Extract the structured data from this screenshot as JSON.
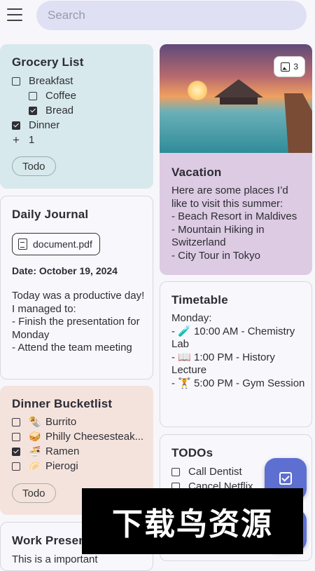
{
  "search": {
    "placeholder": "Search"
  },
  "grocery": {
    "title": "Grocery List",
    "items": [
      {
        "label": "Breakfast",
        "checked": false,
        "indent": false
      },
      {
        "label": "Coffee",
        "checked": false,
        "indent": true
      },
      {
        "label": "Bread",
        "checked": true,
        "indent": true
      },
      {
        "label": "Dinner",
        "checked": true,
        "indent": false
      }
    ],
    "more_label": "1",
    "tag": "Todo"
  },
  "vacation": {
    "image_count": "3",
    "title": "Vacation",
    "body": "Here are some places I’d like to visit this summer:\n- Beach Resort in Maldives\n- Mountain Hiking in Switzerland\n- City Tour in Tokyo"
  },
  "journal": {
    "title": "Daily Journal",
    "attachment": "document.pdf",
    "date": "Date: October 19, 2024",
    "body": "Today was a productive day! I managed to:\n- Finish the presentation for Monday\n- Attend the team meeting"
  },
  "timetable": {
    "title": "Timetable",
    "body": " Monday:\n- 🧪 10:00 AM - Chemistry Lab\n- 📖 1:00 PM - History Lecture\n- 🏋 5:00 PM - Gym Session"
  },
  "dinner": {
    "title": "Dinner Bucketlist",
    "items": [
      {
        "emoji": "🌯",
        "label": "Burrito",
        "checked": false
      },
      {
        "emoji": "🥪",
        "label": "Philly Cheesesteak...",
        "checked": false
      },
      {
        "emoji": "🍜",
        "label": "Ramen",
        "checked": true
      },
      {
        "emoji": "🥟",
        "label": "Pierogi",
        "checked": false
      }
    ],
    "tag": "Todo"
  },
  "todos": {
    "title": "TODOs",
    "items": [
      {
        "label": "Call Dentist",
        "checked": false
      },
      {
        "label": "Cancel Netflix",
        "checked": false
      }
    ]
  },
  "work": {
    "title": "Work Presentation",
    "body": "This is a important"
  },
  "watermark": "下载鸟资源",
  "colors": {
    "grocery_bg": "#d7e9ec",
    "vacation_bg": "#dccbe3",
    "dinner_bg": "#f4e3dd",
    "fab": "#5e6fd2",
    "search_bg": "#dfe0f4"
  }
}
